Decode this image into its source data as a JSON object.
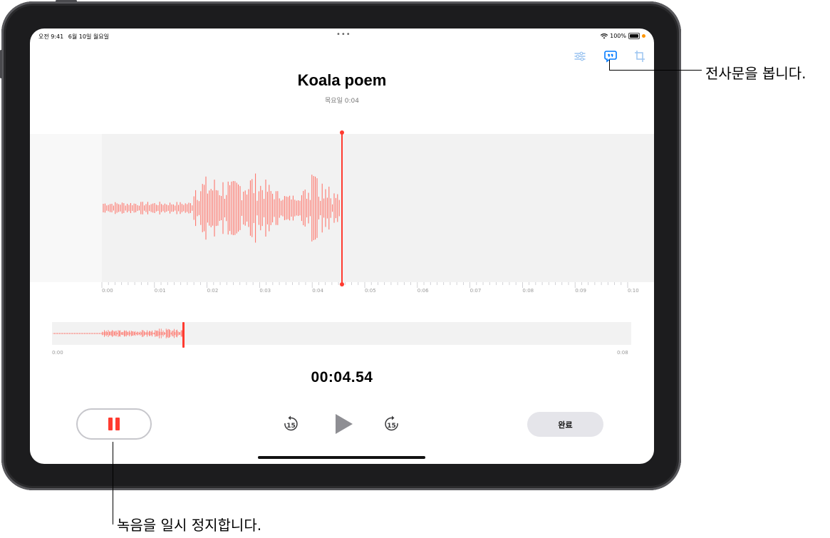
{
  "status": {
    "time": "오전 9:41",
    "date": "6월 10일 월요일",
    "battery": "100%",
    "dots": "•••"
  },
  "recording": {
    "title": "Koala poem",
    "subtitle": "목요일  0:04",
    "elapsed": "00:04.54"
  },
  "timeline": {
    "ticks": [
      "0:00",
      "0:01",
      "0:02",
      "0:03",
      "0:04",
      "0:05",
      "0:06",
      "0:07",
      "0:08",
      "0:09",
      "0:10"
    ]
  },
  "overview": {
    "start": "0:00",
    "end": "0:08"
  },
  "controls": {
    "done_label": "완료",
    "skip_back": "15",
    "skip_forward": "15"
  },
  "colors": {
    "accent": "#ff3b30",
    "link": "#007aff",
    "waveform": "#ff6b60"
  },
  "icons": {
    "options": "sliders-icon",
    "transcript": "transcript-quote-icon",
    "trim": "crop-icon",
    "pause": "pause-icon",
    "play": "play-icon"
  },
  "callouts": {
    "transcript": "전사문을 봅니다.",
    "pause": "녹음을 일시 정지합니다."
  }
}
